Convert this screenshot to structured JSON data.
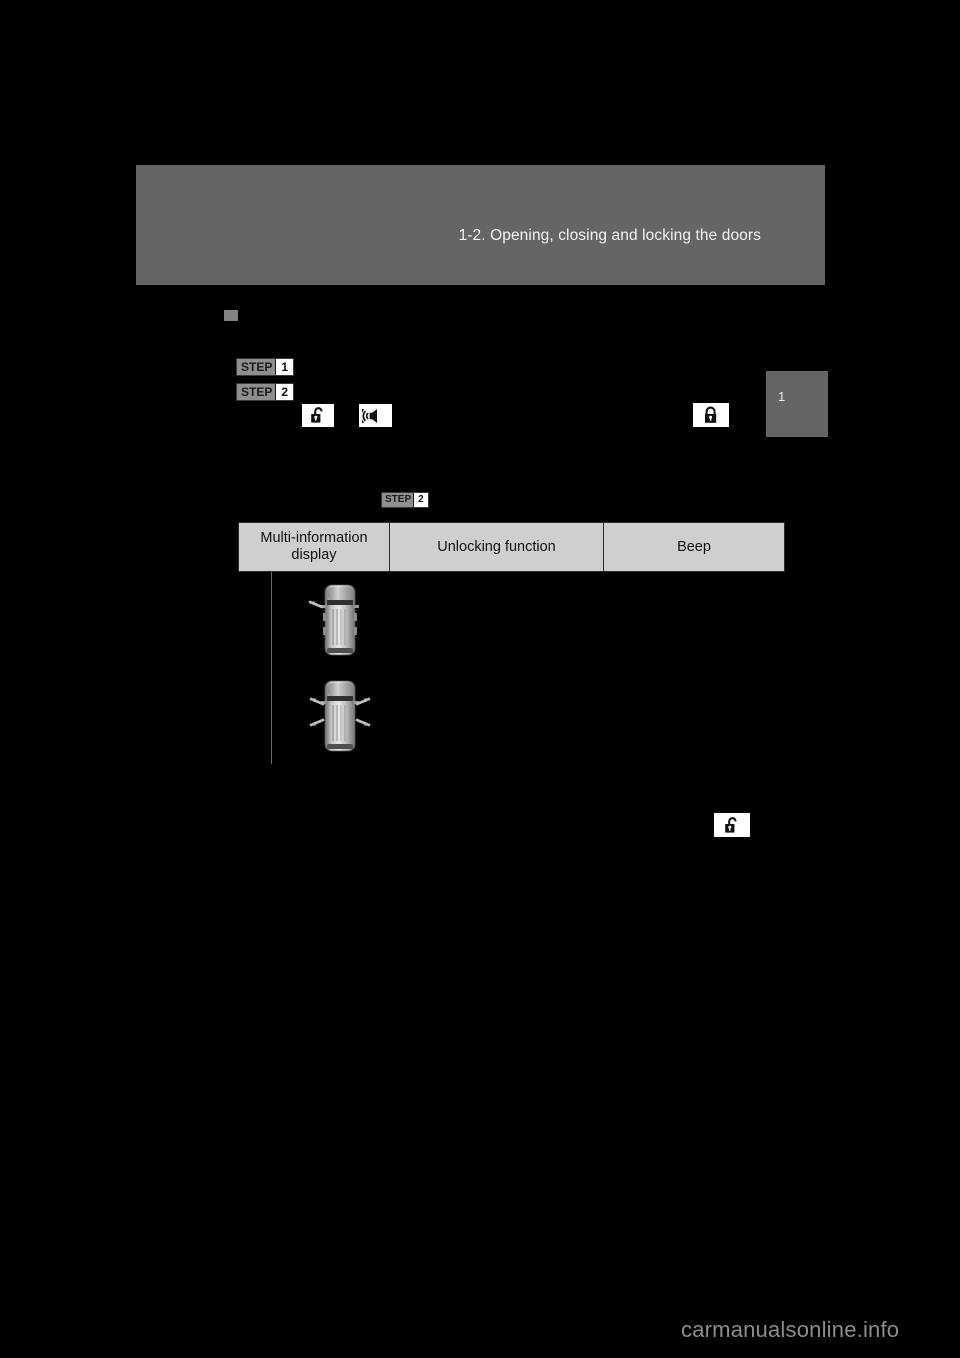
{
  "page": {
    "background_color": "#000000",
    "watermark": "carmanualsonline.info"
  },
  "header": {
    "title": "1-2. Opening, closing and locking the doors",
    "banner_color": "#656565"
  },
  "chapter_tab": {
    "number": "1",
    "color": "#656565"
  },
  "section": {
    "bullet_color": "#828282",
    "heading": ""
  },
  "steps": [
    {
      "word": "STEP",
      "number": "1",
      "text": ""
    },
    {
      "word": "STEP",
      "number": "2",
      "text": ""
    }
  ],
  "inline_step": {
    "word": "STEP",
    "number": "2"
  },
  "icons": {
    "unlock_primary": "unlock-icon",
    "beep": "beep-speaker-icon",
    "lock": "lock-icon",
    "unlock_secondary": "unlock-icon"
  },
  "table": {
    "columns": [
      "Multi-information display",
      "Unlocking function",
      "Beep"
    ],
    "header_bg": "#cfcfcf",
    "rows": [
      {
        "display": "driver-door-unlock-vehicle-icon",
        "display_arrows": 1,
        "unlocking_function": "",
        "beep": ""
      },
      {
        "display": "all-doors-unlock-vehicle-icon",
        "display_arrows": 4,
        "unlocking_function": "",
        "beep": ""
      }
    ]
  },
  "body_text": {
    "heading": "",
    "step1": "",
    "step2": "",
    "after_steps": "",
    "note": "",
    "footer": ""
  }
}
